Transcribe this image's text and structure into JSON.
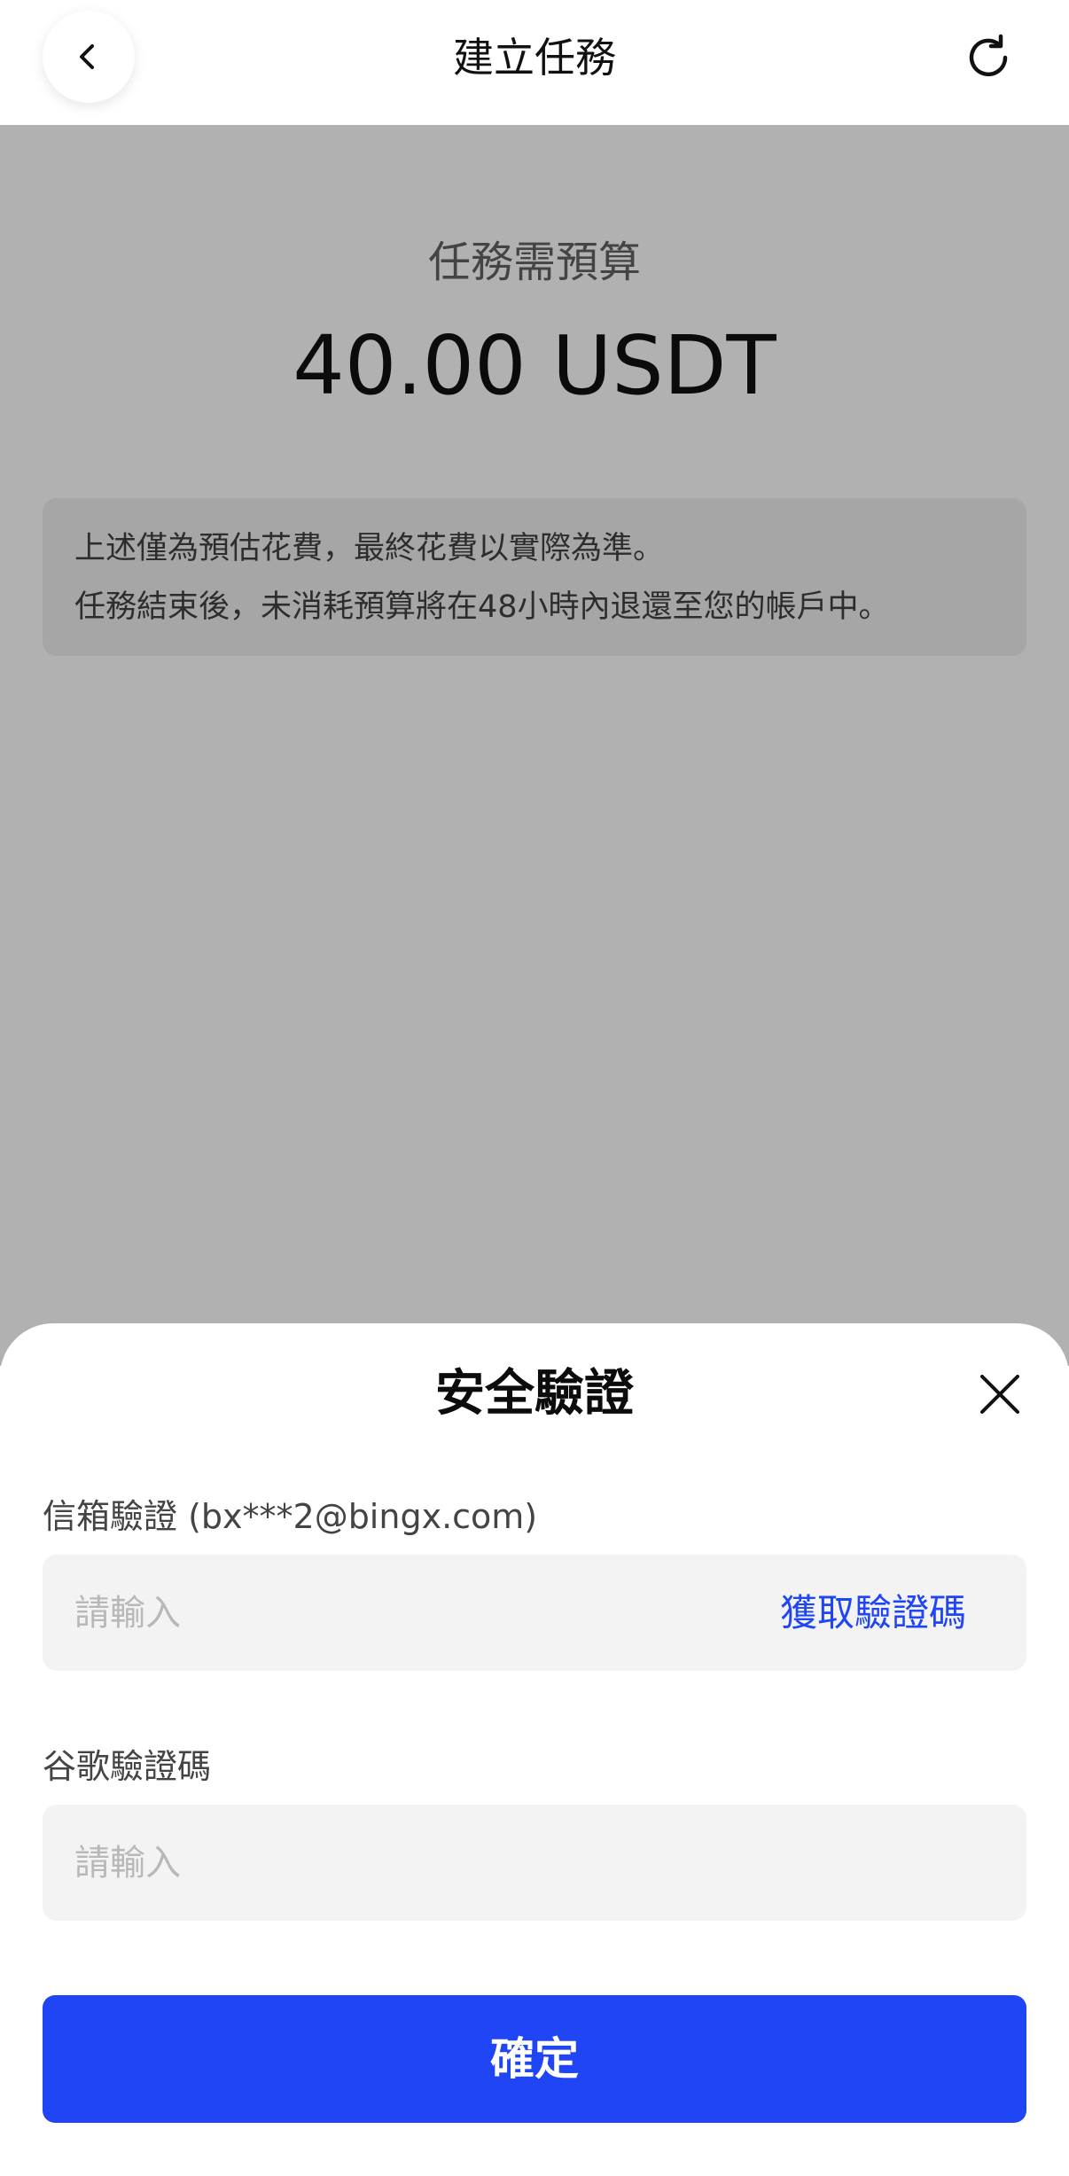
{
  "header": {
    "title": "建立任務"
  },
  "budget": {
    "label": "任務需預算",
    "amount": "40.00 USDT"
  },
  "notice": {
    "line1": "上述僅為預估花費，最終花費以實際為準。",
    "line2": "任務結束後，未消耗預算將在48小時內退還至您的帳戶中。"
  },
  "sheet": {
    "title": "安全驗證",
    "email": {
      "label": "信箱驗證 (bx***2@bingx.com)",
      "placeholder": "請輸入",
      "value": "",
      "get_code_label": "獲取驗證碼"
    },
    "google": {
      "label": "谷歌驗證碼",
      "placeholder": "請輸入",
      "value": ""
    },
    "confirm_label": "確定"
  },
  "colors": {
    "accent": "#1f45f5",
    "overlay": "#b1b1b1",
    "input_bg": "#f3f3f3"
  },
  "icons": {
    "back": "chevron-left-icon",
    "refresh": "refresh-icon",
    "close": "close-icon"
  }
}
